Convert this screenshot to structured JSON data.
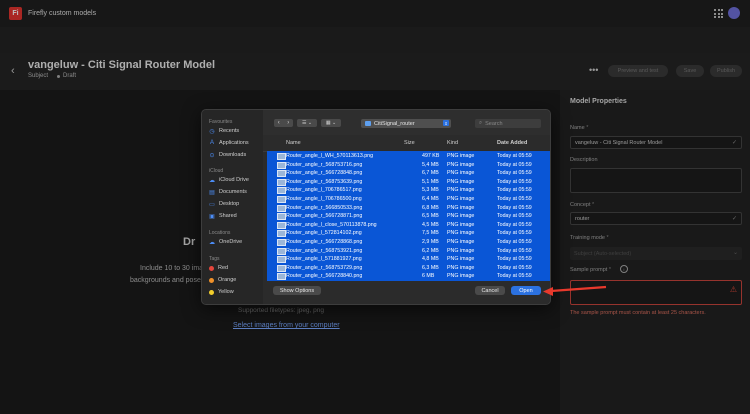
{
  "app": {
    "logo": "Fi",
    "title": "Firefly custom models"
  },
  "header": {
    "model_title": "vangeluw - Citi Signal Router Model",
    "subject": "Subject",
    "status": "Draft",
    "preview_label": "Preview and test",
    "save_label": "Save",
    "publish_label": "Publish"
  },
  "main": {
    "drop_title": "Dr",
    "line1": "Include 10 to 30 imag",
    "line2": "backgrounds and poses. E",
    "supported": "Supported filetypes: jpeg, png",
    "select_link": "Select images from your computer"
  },
  "panel": {
    "title": "Model Properties",
    "name_label": "Name",
    "name_value": "vangeluw - Citi Signal Router Model",
    "description_label": "Description",
    "concept_label": "Concept",
    "concept_value": "router",
    "training_mode_label": "Training mode",
    "training_mode_value": "Subject (Auto-selected)",
    "sample_prompt_label": "Sample prompt",
    "error_text": "The sample prompt must contain at least 25 characters."
  },
  "dialog": {
    "sidebar": {
      "favourites_head": "Favourites",
      "favourites": [
        "Recents",
        "Applications",
        "Downloads"
      ],
      "icloud_head": "iCloud",
      "icloud": [
        "iCloud Drive",
        "Documents",
        "Desktop",
        "Shared"
      ],
      "locations_head": "Locations",
      "locations": [
        "OneDrive"
      ],
      "tags_head": "Tags",
      "tags": [
        {
          "label": "Red",
          "color": "#e5463c"
        },
        {
          "label": "Orange",
          "color": "#f0912a"
        },
        {
          "label": "Yellow",
          "color": "#f3cf2c"
        }
      ]
    },
    "folder": "CitiSignal_router",
    "search_placeholder": "Search",
    "columns": {
      "name": "Name",
      "size": "Size",
      "kind": "Kind",
      "date": "Date Added"
    },
    "files": [
      {
        "name": "Router_angle_l_WH_570113613.png",
        "size": "497 KB",
        "kind": "PNG image",
        "date": "Today at 05:59"
      },
      {
        "name": "Router_angle_r_568753716.png",
        "size": "5,4 MB",
        "kind": "PNG image",
        "date": "Today at 05:59"
      },
      {
        "name": "Router_angle_r_566728848.png",
        "size": "6,7 MB",
        "kind": "PNG image",
        "date": "Today at 05:59"
      },
      {
        "name": "Router_angle_r_568753639.png",
        "size": "5,1 MB",
        "kind": "PNG image",
        "date": "Today at 05:59"
      },
      {
        "name": "Router_angle_l_706786517.png",
        "size": "5,3 MB",
        "kind": "PNG image",
        "date": "Today at 05:59"
      },
      {
        "name": "Router_angle_l_706786500.png",
        "size": "6,4 MB",
        "kind": "PNG image",
        "date": "Today at 05:59"
      },
      {
        "name": "Router_angle_r_566850533.png",
        "size": "6,8 MB",
        "kind": "PNG image",
        "date": "Today at 05:59"
      },
      {
        "name": "Router_angle_r_566728871.png",
        "size": "6,5 MB",
        "kind": "PNG image",
        "date": "Today at 05:59"
      },
      {
        "name": "Router_angle_l_close_570113878.png",
        "size": "4,5 MB",
        "kind": "PNG image",
        "date": "Today at 05:59"
      },
      {
        "name": "Router_angle_l_572814102.png",
        "size": "7,5 MB",
        "kind": "PNG image",
        "date": "Today at 05:59"
      },
      {
        "name": "Router_angle_r_566728868.png",
        "size": "2,9 MB",
        "kind": "PNG image",
        "date": "Today at 05:59"
      },
      {
        "name": "Router_angle_r_568753921.png",
        "size": "6,2 MB",
        "kind": "PNG image",
        "date": "Today at 05:59"
      },
      {
        "name": "Router_angle_l_571881927.png",
        "size": "4,8 MB",
        "kind": "PNG image",
        "date": "Today at 05:59"
      },
      {
        "name": "Router_angle_r_568753729.png",
        "size": "6,3 MB",
        "kind": "PNG image",
        "date": "Today at 05:59"
      },
      {
        "name": "Router_angle_r_566728840.png",
        "size": "6 MB",
        "kind": "PNG image",
        "date": "Today at 05:59"
      }
    ],
    "show_options": "Show Options",
    "cancel": "Cancel",
    "open": "Open"
  },
  "colors": {
    "selection": "#0a56d6",
    "accent": "#2b71e0",
    "arrow": "#e8392c"
  }
}
